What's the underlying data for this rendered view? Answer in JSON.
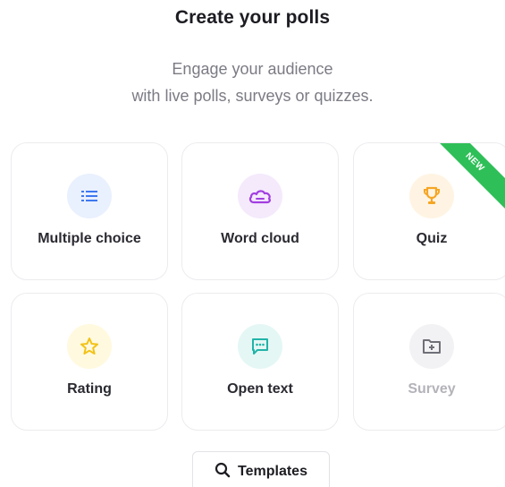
{
  "header": {
    "title": "Create your polls",
    "subtitle_line1": "Engage your audience",
    "subtitle_line2": "with live polls, surveys or quizzes."
  },
  "cards": [
    {
      "label": "Multiple choice",
      "icon": "list-icon",
      "icon_color": "#3d78f0",
      "icon_bg": "#e9f0fe",
      "enabled": true
    },
    {
      "label": "Word cloud",
      "icon": "cloud-icon",
      "icon_color": "#a23fe0",
      "icon_bg": "#f4eafc",
      "enabled": true
    },
    {
      "label": "Quiz",
      "icon": "trophy-icon",
      "icon_color": "#f5a623",
      "icon_bg": "#fff4e3",
      "enabled": true,
      "badge": "NEW",
      "badge_color": "#2fbf58"
    },
    {
      "label": "Rating",
      "icon": "star-icon",
      "icon_color": "#f2c318",
      "icon_bg": "#fff9df",
      "enabled": true
    },
    {
      "label": "Open text",
      "icon": "chat-icon",
      "icon_color": "#22b3a8",
      "icon_bg": "#e4f7f5",
      "enabled": true
    },
    {
      "label": "Survey",
      "icon": "folder-plus-icon",
      "icon_color": "#9a9aa3",
      "icon_bg": "#f2f2f4",
      "enabled": false
    }
  ],
  "templates_button": {
    "label": "Templates",
    "icon": "search-icon"
  }
}
